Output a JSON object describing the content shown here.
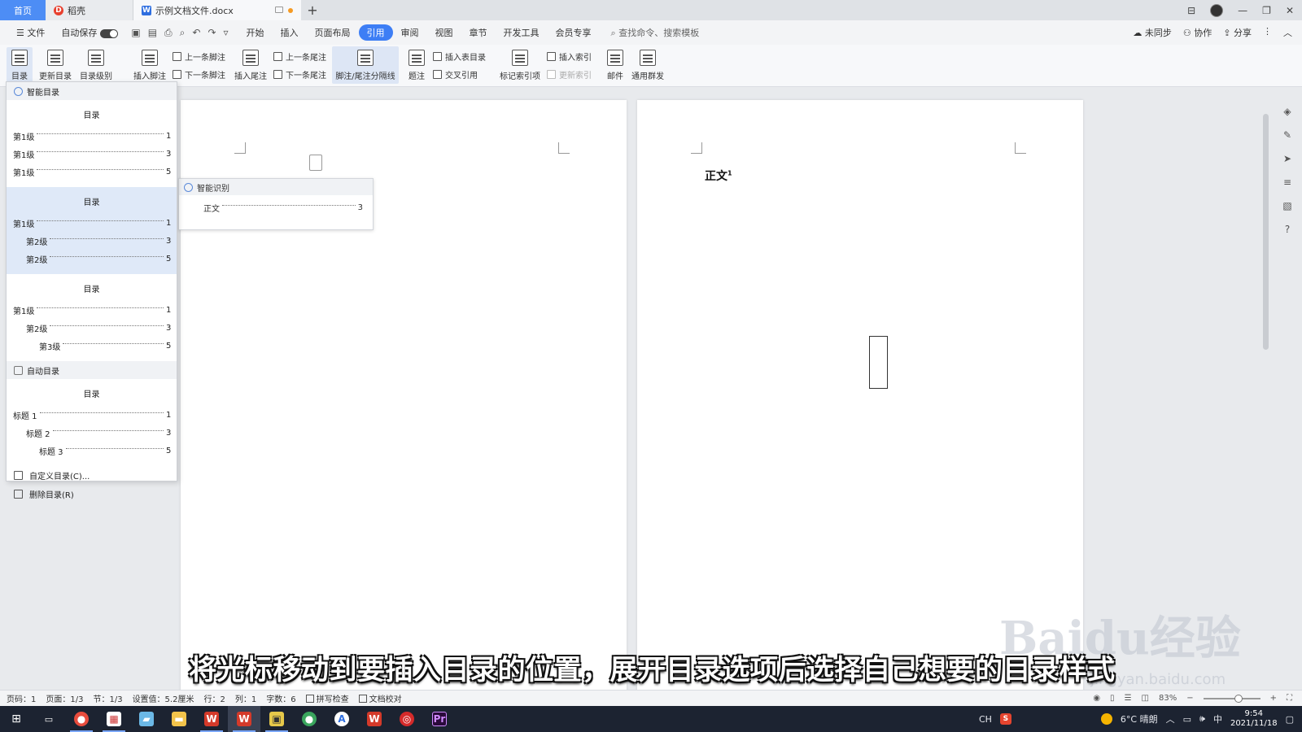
{
  "tabs": {
    "home": "首页",
    "daoke": "稻壳",
    "document": "示例文档文件.docx",
    "add": "+"
  },
  "menubar": {
    "file": "文件",
    "autosave": "自动保存",
    "items": [
      "开始",
      "插入",
      "页面布局",
      "引用",
      "审阅",
      "视图",
      "章节",
      "开发工具",
      "会员专享"
    ],
    "active_index": 3,
    "search_placeholder": "查找命令、搜索模板",
    "right": [
      "未同步",
      "协作",
      "分享"
    ]
  },
  "ribbon": {
    "toc": "目录",
    "update_toc": "更新目录",
    "toc_level": "目录级别",
    "insert_footnote": "插入脚注",
    "prev_footnote": "上一条脚注",
    "next_footnote": "下一条脚注",
    "insert_endnote": "插入尾注",
    "prev_endnote": "上一条尾注",
    "next_endnote": "下一条尾注",
    "separator": "脚注/尾注分隔线",
    "caption": "题注",
    "insert_table_toc": "插入表目录",
    "cross_ref": "交叉引用",
    "mark_index": "标记索引项",
    "insert_index": "插入索引",
    "update_index": "更新索引",
    "mail": "邮件",
    "mass_send": "通用群发"
  },
  "toc_panel": {
    "smart_section": "智能目录",
    "auto_section": "自动目录",
    "templates": [
      {
        "title": "目录",
        "lines": [
          {
            "text": "第1级",
            "page": "1",
            "indent": 0
          },
          {
            "text": "第1级",
            "page": "3",
            "indent": 0
          },
          {
            "text": "第1级",
            "page": "5",
            "indent": 0
          }
        ]
      },
      {
        "title": "目录",
        "lines": [
          {
            "text": "第1级",
            "page": "1",
            "indent": 0
          },
          {
            "text": "第2级",
            "page": "3",
            "indent": 1
          },
          {
            "text": "第2级",
            "page": "5",
            "indent": 1
          }
        ]
      },
      {
        "title": "目录",
        "lines": [
          {
            "text": "第1级",
            "page": "1",
            "indent": 0
          },
          {
            "text": "第2级",
            "page": "3",
            "indent": 1
          },
          {
            "text": "第3级",
            "page": "5",
            "indent": 2
          }
        ]
      }
    ],
    "auto_template": {
      "title": "目录",
      "lines": [
        {
          "text": "标题 1",
          "page": "1",
          "indent": 0
        },
        {
          "text": "标题 2",
          "page": "3",
          "indent": 1
        },
        {
          "text": "标题 3",
          "page": "5",
          "indent": 2
        }
      ]
    },
    "custom": "自定义目录(C)...",
    "delete": "删除目录(R)"
  },
  "smart_popup": {
    "header": "智能识别",
    "entry": "正文",
    "page": "3"
  },
  "document": {
    "heading": "正文",
    "heading_sup": "1"
  },
  "subtitle": "将光标移动到要插入目录的位置，展开目录选项后选择自己想要的目录样式",
  "watermark": {
    "brand": "Baidu经验",
    "url": "jingyan.baidu.com"
  },
  "statusbar": {
    "page_num": "页码：1",
    "pages": "页面：1/3",
    "section": "节：1/3",
    "setting": "设置值：5.2厘米",
    "row": "行：2",
    "col": "列：1",
    "words": "字数：6",
    "spell": "拼写检查",
    "proof": "文档校对",
    "zoom": "83%"
  },
  "taskbar": {
    "weather": "6°C 晴朗",
    "ime": "中",
    "time": "9:54",
    "date": "2021/11/18"
  }
}
